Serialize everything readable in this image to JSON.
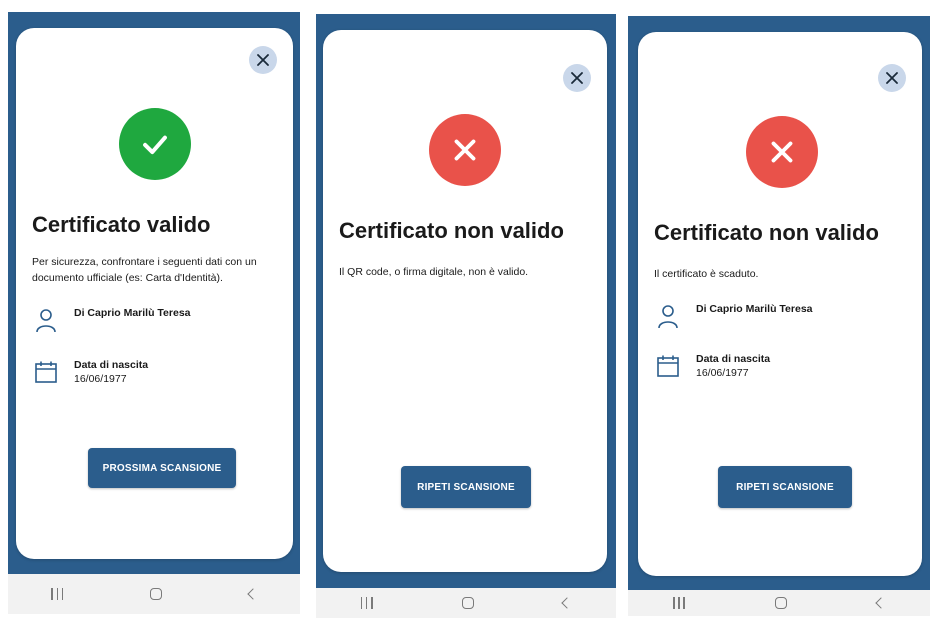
{
  "screens": [
    {
      "status": "valid",
      "status_icon": "check-icon",
      "status_color": "#1fa83f",
      "title": "Certificato valido",
      "description": "Per sicurezza, confrontare i seguenti dati con un documento ufficiale (es: Carta d'Identità).",
      "person": {
        "name": "Di Caprio Marilù Teresa"
      },
      "birth": {
        "label": "Data di nascita",
        "value": "16/06/1977"
      },
      "button_label": "PROSSIMA SCANSIONE"
    },
    {
      "status": "invalid",
      "status_icon": "cross-icon",
      "status_color": "#e9524a",
      "title": "Certificato non valido",
      "description": "Il QR code, o firma digitale, non è valido.",
      "button_label": "RIPETI SCANSIONE"
    },
    {
      "status": "invalid",
      "status_icon": "cross-icon",
      "status_color": "#e9524a",
      "title": "Certificato non valido",
      "description": "Il certificato è scaduto.",
      "person": {
        "name": "Di Caprio Marilù Teresa"
      },
      "birth": {
        "label": "Data di nascita",
        "value": "16/06/1977"
      },
      "button_label": "RIPETI SCANSIONE"
    }
  ],
  "colors": {
    "brand_blue": "#2b5d8c",
    "close_bg": "#c9d7ea",
    "nav_bar_bg": "#f2f2f2"
  },
  "navbar_icons": [
    "recent-apps-icon",
    "home-icon",
    "back-icon"
  ]
}
